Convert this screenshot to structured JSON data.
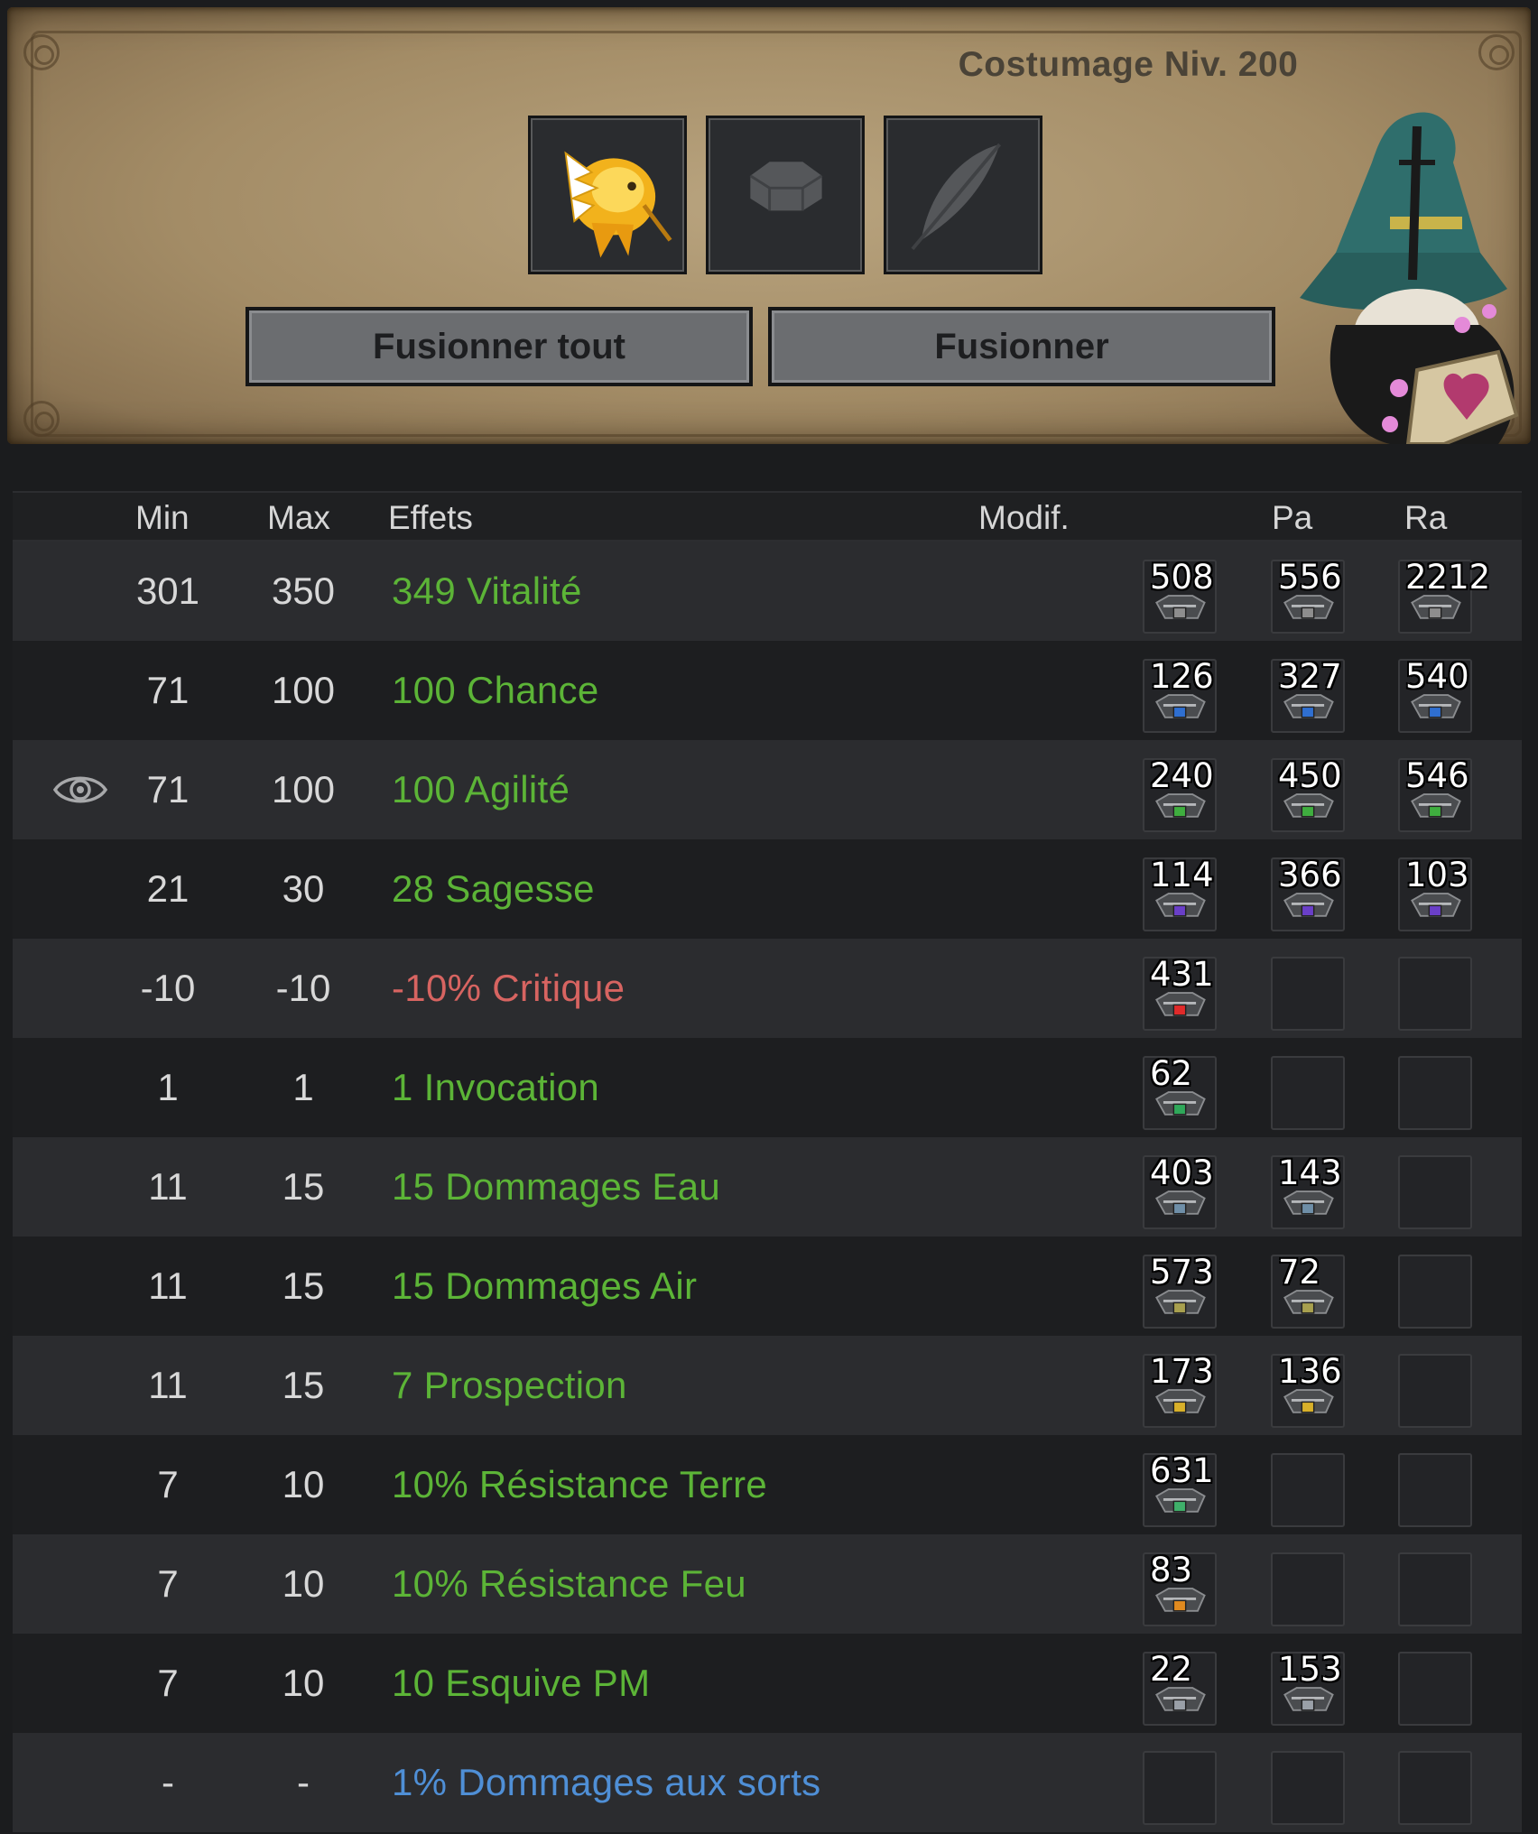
{
  "header": {
    "level_text": "Costumage Niv. 200",
    "slots": [
      {
        "icon": "golden-bird-icon"
      },
      {
        "icon": "hexagon-slot-icon"
      },
      {
        "icon": "feather-slot-icon"
      }
    ],
    "buttons": {
      "fuse_all": "Fusionner tout",
      "fuse": "Fusionner"
    }
  },
  "table": {
    "columns": {
      "min": "Min",
      "max": "Max",
      "effects": "Effets",
      "modif": "Modif.",
      "pa": "Pa",
      "ra": "Ra"
    },
    "colors": {
      "positive": "#5cb437",
      "negative": "#d76461",
      "special": "#4f8fd6"
    },
    "rows": [
      {
        "min": "301",
        "max": "350",
        "effect": "349 Vitalité",
        "kind": "positive",
        "runes": [
          "508",
          "556",
          "2212"
        ],
        "rune_color": "#8e8e8e"
      },
      {
        "min": "71",
        "max": "100",
        "effect": "100 Chance",
        "kind": "positive",
        "runes": [
          "126",
          "327",
          "540"
        ],
        "rune_color": "#2f6fd0"
      },
      {
        "min": "71",
        "max": "100",
        "effect": "100 Agilité",
        "kind": "positive",
        "runes": [
          "240",
          "450",
          "546"
        ],
        "rune_color": "#3fae3f",
        "eye": true
      },
      {
        "min": "21",
        "max": "30",
        "effect": "28 Sagesse",
        "kind": "positive",
        "runes": [
          "114",
          "366",
          "103"
        ],
        "rune_color": "#6a3fc8"
      },
      {
        "min": "-10",
        "max": "-10",
        "effect": "-10% Critique",
        "kind": "negative",
        "runes": [
          "431",
          "",
          ""
        ],
        "rune_color": "#e02a2a"
      },
      {
        "min": "1",
        "max": "1",
        "effect": "1 Invocation",
        "kind": "positive",
        "runes": [
          "62",
          "",
          ""
        ],
        "rune_color": "#2fa85a"
      },
      {
        "min": "11",
        "max": "15",
        "effect": "15 Dommages Eau",
        "kind": "positive",
        "runes": [
          "403",
          "143",
          ""
        ],
        "rune_color": "#6f8fa8"
      },
      {
        "min": "11",
        "max": "15",
        "effect": "15 Dommages Air",
        "kind": "positive",
        "runes": [
          "573",
          "72",
          ""
        ],
        "rune_color": "#a8a04f"
      },
      {
        "min": "11",
        "max": "15",
        "effect": "7 Prospection",
        "kind": "positive",
        "runes": [
          "173",
          "136",
          ""
        ],
        "rune_color": "#d8b02a"
      },
      {
        "min": "7",
        "max": "10",
        "effect": "10% Résistance Terre",
        "kind": "positive",
        "runes": [
          "631",
          "",
          ""
        ],
        "rune_color": "#3fb06a"
      },
      {
        "min": "7",
        "max": "10",
        "effect": "10% Résistance Feu",
        "kind": "positive",
        "runes": [
          "83",
          "",
          ""
        ],
        "rune_color": "#e08a1f"
      },
      {
        "min": "7",
        "max": "10",
        "effect": "10 Esquive PM",
        "kind": "positive",
        "runes": [
          "22",
          "153",
          ""
        ],
        "rune_color": "#9aa0a8"
      },
      {
        "min": "-",
        "max": "-",
        "effect": "1% Dommages aux sorts",
        "kind": "special",
        "runes": [
          "",
          "",
          ""
        ],
        "rune_color": "#4f8fd6"
      }
    ]
  }
}
